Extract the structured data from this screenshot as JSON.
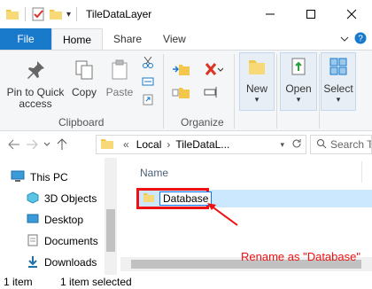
{
  "window": {
    "title": "TileDataLayer",
    "quick_access_dropdown": "▾"
  },
  "tabs": [
    {
      "label": "File"
    },
    {
      "label": "Home"
    },
    {
      "label": "Share"
    },
    {
      "label": "View"
    }
  ],
  "ribbon": {
    "clipboard": {
      "pin_label": "Pin to Quick access",
      "copy_label": "Copy",
      "paste_label": "Paste",
      "group_label": "Clipboard"
    },
    "organize": {
      "group_label": "Organize"
    },
    "new_label": "New",
    "open_label": "Open",
    "select_label": "Select"
  },
  "address": {
    "breadcrumb_prefix": "«",
    "segments": [
      "Local",
      "TileDataL..."
    ],
    "search_placeholder": "Search Til..."
  },
  "nav": {
    "items": [
      {
        "label": "This PC"
      },
      {
        "label": "3D Objects"
      },
      {
        "label": "Desktop"
      },
      {
        "label": "Documents"
      },
      {
        "label": "Downloads"
      }
    ]
  },
  "content": {
    "column_name": "Name",
    "item_name": "Database"
  },
  "annotation": "Rename as \"Database\"",
  "status": {
    "count": "1 item",
    "selected": "1 item selected"
  },
  "colors": {
    "accent": "#1979ca",
    "annotation": "#e11111",
    "folder": "#f3c64c",
    "selection": "#cce8ff"
  }
}
